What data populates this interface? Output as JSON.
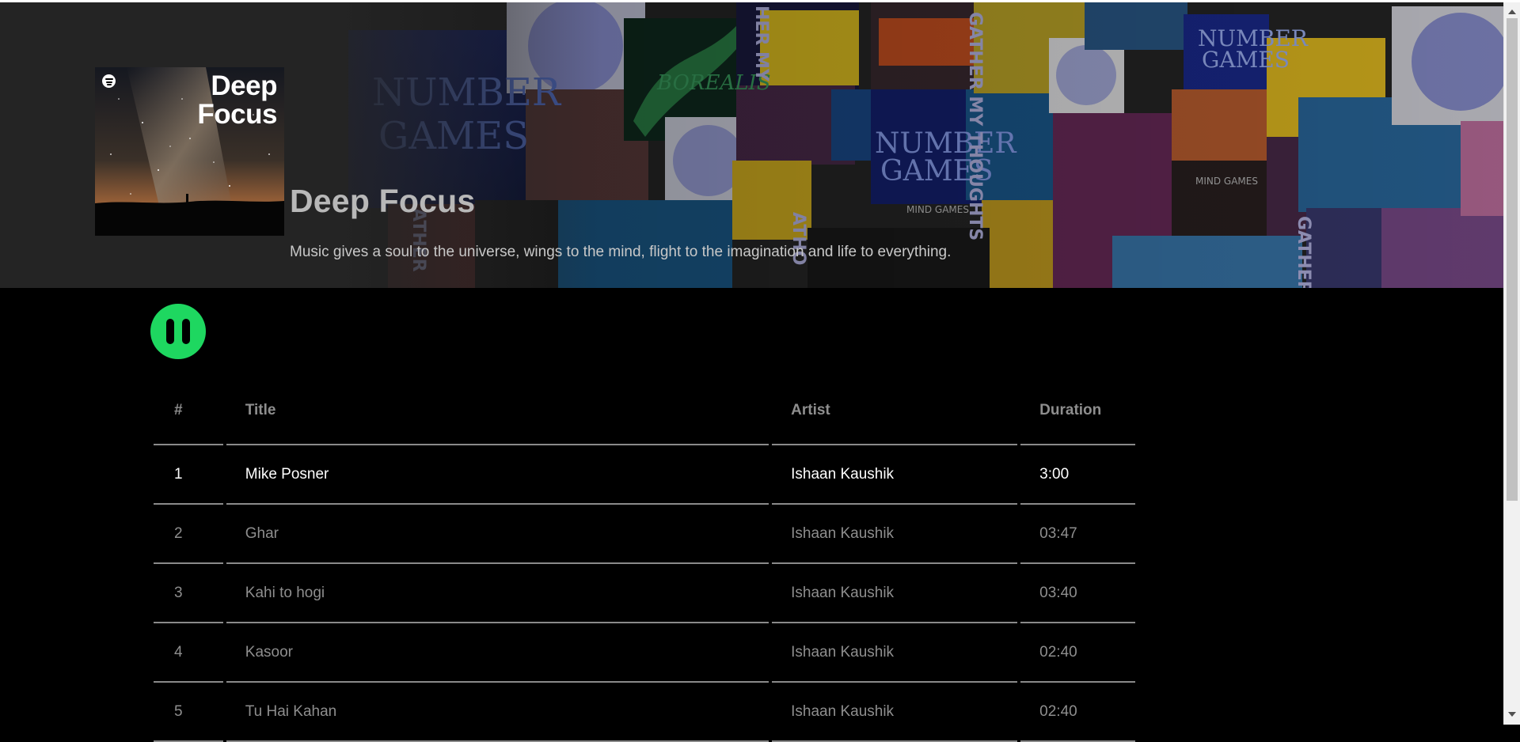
{
  "playlist": {
    "title": "Deep Focus",
    "description": "Music gives a soul to the universe, wings to the mind, flight to the imagination and life to everything.",
    "cover_title_line1": "Deep",
    "cover_title_line2": "Focus"
  },
  "player": {
    "state": "playing",
    "button_icon": "pause-icon",
    "accent_color": "#1ed760"
  },
  "table": {
    "headers": {
      "num": "#",
      "title": "Title",
      "artist": "Artist",
      "duration": "Duration"
    },
    "rows": [
      {
        "num": "1",
        "title": "Mike Posner",
        "artist": "Ishaan Kaushik",
        "duration": "3:00"
      },
      {
        "num": "2",
        "title": "Ghar",
        "artist": "Ishaan Kaushik",
        "duration": "03:47"
      },
      {
        "num": "3",
        "title": "Kahi to hogi",
        "artist": "Ishaan Kaushik",
        "duration": "03:40"
      },
      {
        "num": "4",
        "title": "Kasoor",
        "artist": "Ishaan Kaushik",
        "duration": "02:40"
      },
      {
        "num": "5",
        "title": "Tu Hai Kahan",
        "artist": "Ishaan Kaushik",
        "duration": "02:40"
      }
    ],
    "active_row": 1
  },
  "collage": {
    "album_text_1": "NUMBER",
    "album_text_2": "GAMES",
    "album_text_3": "GATHER MY THOUGHTS",
    "album_text_4": "MIND GAMES",
    "album_text_5": "BOREALIS"
  }
}
